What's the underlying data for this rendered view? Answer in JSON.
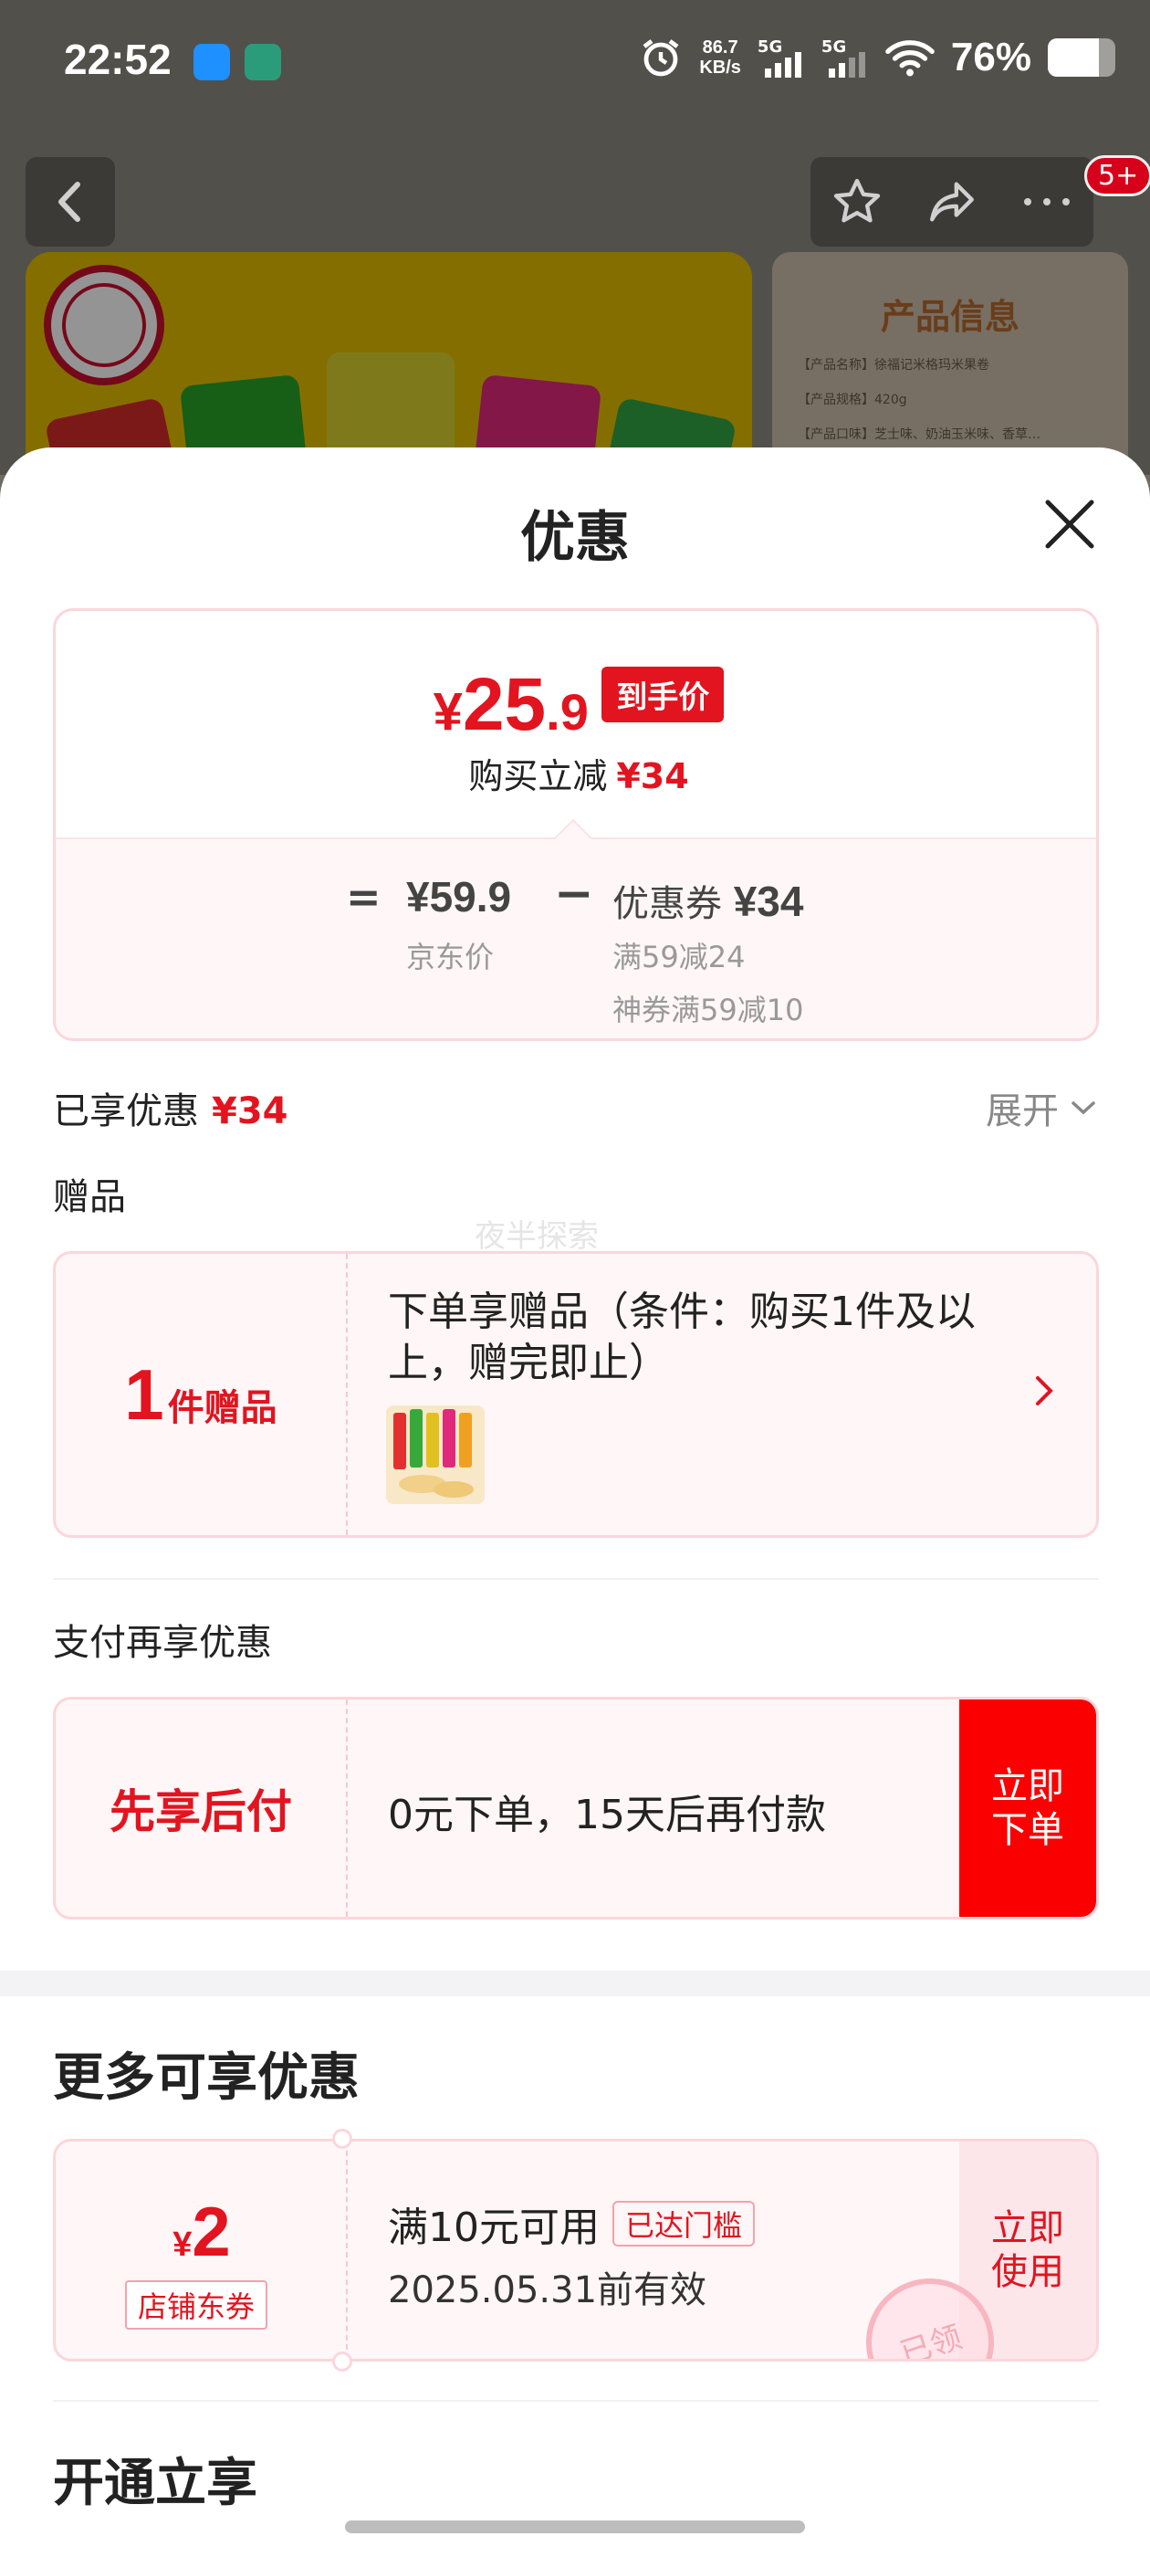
{
  "status_bar": {
    "time": "22:52",
    "net_speed_value": "86.7",
    "net_speed_unit": "KB/s",
    "signal1_label": "5G",
    "signal2_label": "5G",
    "battery": "76%"
  },
  "background_page": {
    "badge_count": "5+",
    "info_card_title": "产品信息",
    "info_rows": [
      "【产品名称】徐福记米格玛米果卷",
      "【产品规格】420g",
      "【产品口味】芝士味、奶油玉米味、香草…"
    ]
  },
  "sheet": {
    "title": "优惠",
    "price": {
      "symbol": "¥",
      "integer": "25",
      "decimal": ".9",
      "tag": "到手价",
      "reduce_label": "购买立减",
      "reduce_value": "¥34",
      "equals": "=",
      "jd_price": "¥59.9",
      "jd_label": "京东价",
      "minus": "−",
      "coupon_label": "优惠券",
      "coupon_value": "¥34",
      "condition1": "满59减24",
      "condition2": "神券满59减10"
    },
    "enjoyed": {
      "label": "已享优惠",
      "value": "¥34",
      "expand_label": "展开"
    },
    "gift": {
      "section_label": "赠品",
      "count": "1",
      "unit": "件赠品",
      "text": "下单享赠品（条件：购买1件及以上，赠完即止）"
    },
    "pay": {
      "section_label": "支付再享优惠",
      "left_label": "先享后付",
      "text": "0元下单，15天后再付款",
      "button": "立即下单"
    },
    "more": {
      "title": "更多可享优惠",
      "coupon": {
        "symbol": "¥",
        "amount": "2",
        "type": "店铺东券",
        "condition": "满10元可用",
        "reached": "已达门槛",
        "valid": "2025.05.31前有效",
        "button": "立即使用",
        "stamp": "已领"
      }
    },
    "open_title": "开通立享",
    "watermark": "夜半探索"
  },
  "colors": {
    "accent_red": "#e2141f",
    "button_red": "#fa0000",
    "card_border": "#fbd6dc",
    "card_bg": "#fff6f7"
  }
}
